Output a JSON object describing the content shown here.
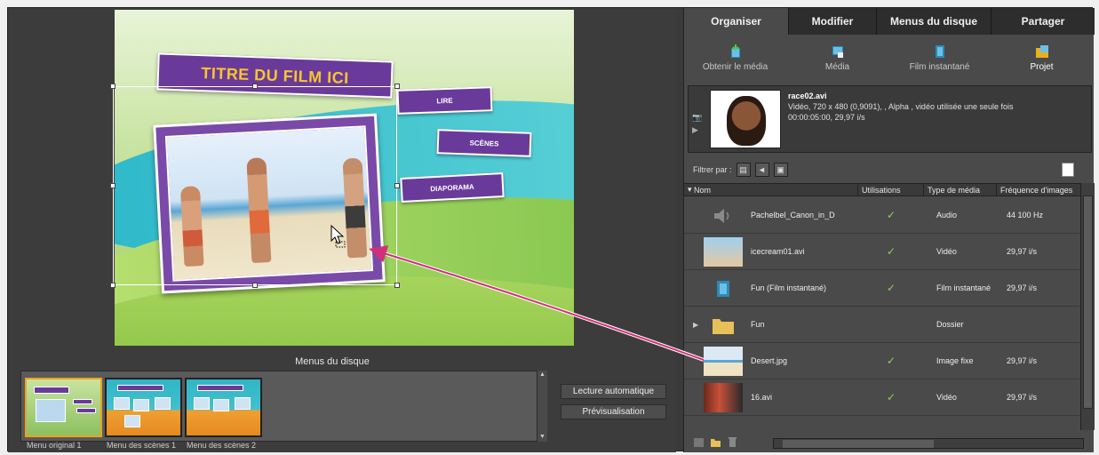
{
  "stage": {
    "title_text": "TITRE DU FILM ICI",
    "buttons": [
      "LIRE",
      "SCÈNES",
      "DIAPORAMA"
    ]
  },
  "menus_section": {
    "label": "Menus du disque",
    "thumbnails": [
      {
        "label": "Menu original 1"
      },
      {
        "label": "Menu des scènes 1"
      },
      {
        "label": "Menu des scènes 2"
      }
    ]
  },
  "actions": {
    "autoplay": "Lecture automatique",
    "preview": "Prévisualisation"
  },
  "tabs": [
    "Organiser",
    "Modifier",
    "Menus du disque",
    "Partager"
  ],
  "toolbar": [
    {
      "label": "Obtenir le média",
      "icon": "download-media-icon"
    },
    {
      "label": "Média",
      "icon": "media-icon"
    },
    {
      "label": "Film instantané",
      "icon": "instant-movie-icon"
    },
    {
      "label": "Projet",
      "icon": "project-icon"
    }
  ],
  "info": {
    "filename": "race02.avi",
    "line1": "Vidéo, 720 x 480 (0,9091), , Alpha   , vidéo utilisée une seule fois",
    "line2": "00:00:05:00, 29,97 i/s"
  },
  "filter": {
    "label": "Filtrer par :"
  },
  "columns": {
    "name": "Nom",
    "uses": "Utilisations",
    "type": "Type de média",
    "fps": "Fréquence d'images"
  },
  "rows": [
    {
      "name": "Pachelbel_Canon_in_D",
      "used": "✓",
      "type": "Audio",
      "fps": "44 100 Hz",
      "kind": "audio"
    },
    {
      "name": "icecream01.avi",
      "used": "✓",
      "type": "Vidéo",
      "fps": "29,97 i/s",
      "kind": "video"
    },
    {
      "name": "Fun (Film instantané)",
      "used": "✓",
      "type": "Film instantané",
      "fps": "29,97 i/s",
      "kind": "instant"
    },
    {
      "name": "Fun",
      "used": "",
      "type": "Dossier",
      "fps": "",
      "kind": "folder"
    },
    {
      "name": "Desert.jpg",
      "used": "✓",
      "type": "Image fixe",
      "fps": "29,97 i/s",
      "kind": "image"
    },
    {
      "name": "16.avi",
      "used": "✓",
      "type": "Vidéo",
      "fps": "29,97 i/s",
      "kind": "video2"
    }
  ],
  "colors": {
    "accent": "#6a3a9a",
    "title_yellow": "#f7c52f",
    "arrow": "#d0307a",
    "check": "#8ed05a"
  }
}
